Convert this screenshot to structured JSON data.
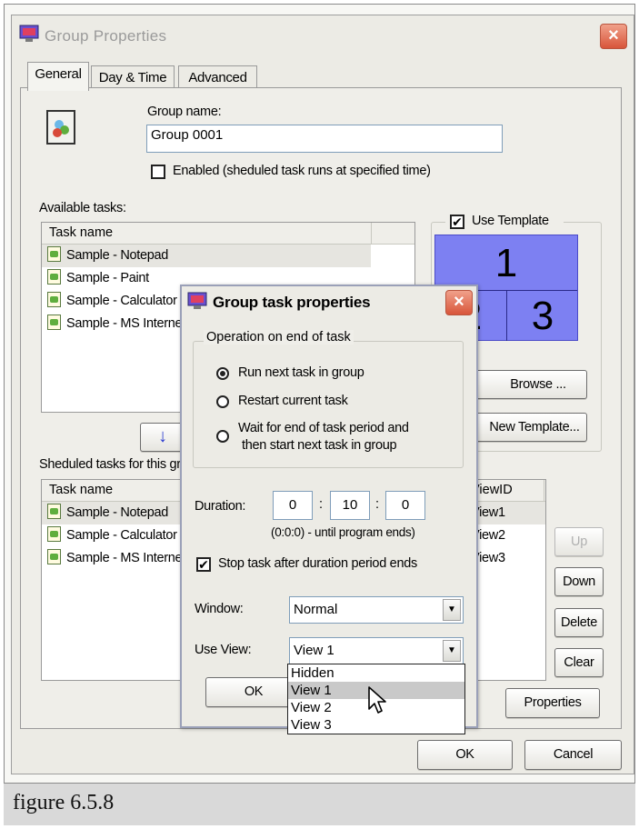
{
  "main_window": {
    "title": "Group Properties",
    "close_label": "×"
  },
  "tabs": [
    {
      "label": "General"
    },
    {
      "label": "Day & Time"
    },
    {
      "label": "Advanced"
    }
  ],
  "general": {
    "group_name_label": "Group name:",
    "group_name_value": "Group 0001",
    "enabled_label": "Enabled (sheduled task runs at specified time)",
    "available_tasks_label": "Available tasks:",
    "available_header": "Task name",
    "available_rows": [
      {
        "name": "Sample - Notepad"
      },
      {
        "name": "Sample - Paint"
      },
      {
        "name": "Sample - Calculator"
      },
      {
        "name": "Sample - MS Internet Explorer"
      }
    ],
    "move_down_icon": "↓",
    "scheduled_label": "Sheduled tasks for this group:",
    "scheduled_header": "Task name",
    "scheduled_viewid_header": "ViewID",
    "scheduled_rows": [
      {
        "name": "Sample - Notepad",
        "view": "View1"
      },
      {
        "name": "Sample - Calculator",
        "view": "View2"
      },
      {
        "name": "Sample - MS Internet Explorer",
        "view": "View3"
      }
    ],
    "use_template_label": "Use Template",
    "use_template_checked": "✔",
    "template_cells": [
      "1",
      "2",
      "3"
    ],
    "browse_label": "Browse ...",
    "new_template_label": "New Template...",
    "up_label": "Up",
    "down_label": "Down",
    "delete_label": "Delete",
    "clear_label": "Clear",
    "properties_label": "Properties"
  },
  "footer": {
    "ok_label": "OK",
    "cancel_label": "Cancel"
  },
  "popup": {
    "title": "Group task properties",
    "close_label": "×",
    "operation_legend": "Operation on end of task",
    "radio_run_next": "Run next task in group",
    "radio_restart": "Restart current task",
    "radio_wait_line1": "Wait for end of task period and",
    "radio_wait_line2": "then start next task in group",
    "duration_label": "Duration:",
    "duration_h": "0",
    "duration_m": "10",
    "duration_s": "0",
    "duration_sep": ":",
    "duration_hint": "(0:0:0) - until program ends)",
    "stop_task_label": "Stop task after duration period ends",
    "stop_task_checked": "✔",
    "window_label": "Window:",
    "window_value": "Normal",
    "use_view_label": "Use View:",
    "use_view_value": "View 1",
    "view_options": [
      "Hidden",
      "View 1",
      "View 2",
      "View 3"
    ],
    "ok_label": "OK",
    "arrow_glyph": "▼"
  },
  "caption": "figure 6.5.8"
}
